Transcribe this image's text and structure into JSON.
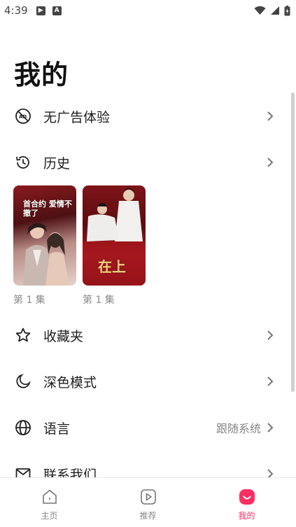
{
  "status_bar": {
    "time": "4:39",
    "left_icons": [
      "play-store-icon",
      "a-notification-icon"
    ],
    "right_icons": [
      "wifi-icon",
      "signal-icon",
      "battery-icon"
    ]
  },
  "page": {
    "title": "我的"
  },
  "menu": {
    "ad_free": {
      "label": "无广告体验",
      "icon": "no-ads-icon"
    },
    "history": {
      "label": "历史",
      "icon": "history-icon"
    },
    "favorites": {
      "label": "收藏夹",
      "icon": "star-icon"
    },
    "dark_mode": {
      "label": "深色模式",
      "icon": "moon-icon"
    },
    "language": {
      "label": "语言",
      "value": "跟随系统",
      "icon": "globe-icon"
    },
    "contact": {
      "label": "联系我们",
      "icon": "mail-icon"
    }
  },
  "history_items": [
    {
      "episode": "第 1 集",
      "poster_text": "首合约 爱情不撤了"
    },
    {
      "episode": "第 1 集",
      "poster_text": "在上"
    }
  ],
  "bottom_nav": [
    {
      "label": "主页",
      "icon": "home-icon",
      "active": false
    },
    {
      "label": "推荐",
      "icon": "play-icon",
      "active": false
    },
    {
      "label": "我的",
      "icon": "profile-smile-icon",
      "active": true
    }
  ],
  "colors": {
    "accent": "#ff2e63",
    "text": "#1f1f1f",
    "muted": "#888888"
  }
}
